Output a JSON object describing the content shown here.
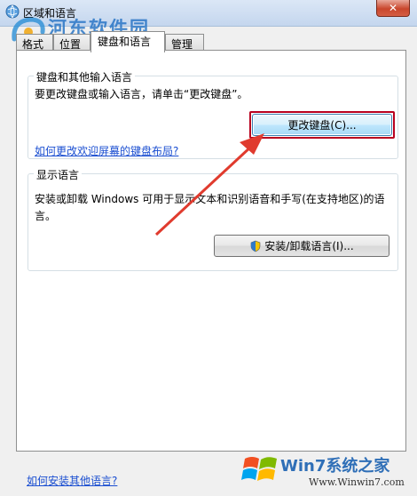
{
  "window": {
    "title": "区域和语言",
    "close_label": "✕"
  },
  "watermark": {
    "main": "河东软件园",
    "sub": "www.pc0359.cn"
  },
  "tabs": [
    {
      "label": "格式"
    },
    {
      "label": "位置"
    },
    {
      "label": "键盘和语言",
      "active": true
    },
    {
      "label": "管理"
    }
  ],
  "keyboard_group": {
    "title": "键盘和其他输入语言",
    "description": "要更改键盘或输入语言，请单击“更改键盘”。",
    "button_label": "更改键盘(C)...",
    "link": "如何更改欢迎屏幕的键盘布局?"
  },
  "display_group": {
    "title": "显示语言",
    "description_line1": "安装或卸载 Windows 可用于显示文本和识别语音和手写(在支持地区)的语",
    "description_line2": "言。",
    "button_label": "安装/卸载语言(I)..."
  },
  "footer_link": "如何安装其他语言?",
  "win7_logo": {
    "main": "Win7系统之家",
    "sub": "Www.Winwin7.com"
  },
  "colors": {
    "arrow": "#e03b2e",
    "link": "#1a4ed1",
    "highlight_border": "#b8001e"
  }
}
